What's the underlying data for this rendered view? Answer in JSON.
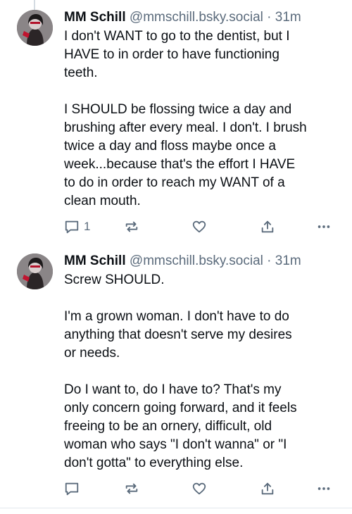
{
  "colors": {
    "text": "#0b0f14",
    "muted": "#5b6b7c",
    "divider": "#e3e8ed",
    "thread_line": "#d4dbe2"
  },
  "posts": [
    {
      "author": "MM Schill",
      "handle": "@mmschill.bsky.social",
      "separator": "·",
      "time": "31m",
      "text": "I don't WANT to go to the dentist, but I\nHAVE to in order to have functioning\nteeth.\n\nI SHOULD be flossing twice a day and\nbrushing after every meal. I don't. I brush\ntwice a day and floss maybe once a\nweek...because that's the effort I HAVE\nto do in order to reach my WANT of a\nclean mouth.",
      "reply_count": "1",
      "icons": [
        "reply-icon",
        "repost-icon",
        "like-icon",
        "share-icon",
        "more-icon"
      ]
    },
    {
      "author": "MM Schill",
      "handle": "@mmschill.bsky.social",
      "separator": "·",
      "time": "31m",
      "text": "Screw SHOULD.\n\nI'm a grown woman. I don't have to do\nanything that doesn't serve my desires\nor needs.\n\nDo I want to, do I have to? That's my\nonly concern going forward, and it feels\nfreeing to be an ornery, difficult, old\nwoman who says \"I don't wanna\" or \"I\ndon't gotta\" to everything else.",
      "reply_count": "",
      "icons": [
        "reply-icon",
        "repost-icon",
        "like-icon",
        "share-icon",
        "more-icon"
      ]
    }
  ]
}
